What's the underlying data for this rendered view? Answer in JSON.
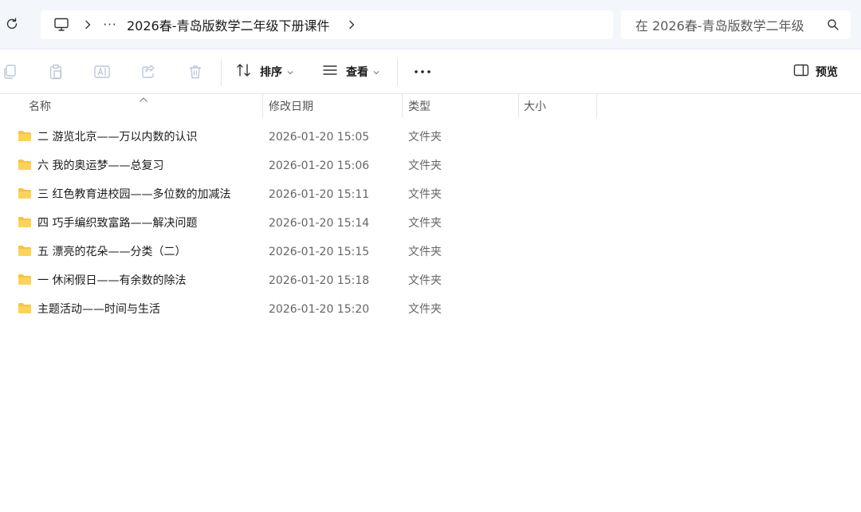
{
  "address_bar": {
    "breadcrumb_overflow": "···",
    "path": "2026春-青岛版数学二年级下册课件",
    "search_placeholder": "在 2026春-青岛版数学二年级"
  },
  "toolbar": {
    "sort_label": "排序",
    "view_label": "查看",
    "more_label": "···",
    "preview_label": "预览"
  },
  "columns": {
    "name": "名称",
    "modified": "修改日期",
    "type": "类型",
    "size": "大小"
  },
  "files": [
    {
      "name": "二 游览北京——万以内数的认识",
      "modified": "2026-01-20 15:05",
      "type": "文件夹"
    },
    {
      "name": "六 我的奥运梦——总复习",
      "modified": "2026-01-20 15:06",
      "type": "文件夹"
    },
    {
      "name": "三 红色教育进校园——多位数的加减法",
      "modified": "2026-01-20 15:11",
      "type": "文件夹"
    },
    {
      "name": "四 巧手编织致富路——解决问题",
      "modified": "2026-01-20 15:14",
      "type": "文件夹"
    },
    {
      "name": "五 漂亮的花朵——分类（二）",
      "modified": "2026-01-20 15:15",
      "type": "文件夹"
    },
    {
      "name": "一 休闲假日——有余数的除法",
      "modified": "2026-01-20 15:18",
      "type": "文件夹"
    },
    {
      "name": "主题活动——时间与生活",
      "modified": "2026-01-20 15:20",
      "type": "文件夹"
    }
  ],
  "icons": {
    "refresh": "refresh-icon",
    "computer": "computer-icon",
    "folder": "folder-icon",
    "folder_color": "#f6c443"
  }
}
